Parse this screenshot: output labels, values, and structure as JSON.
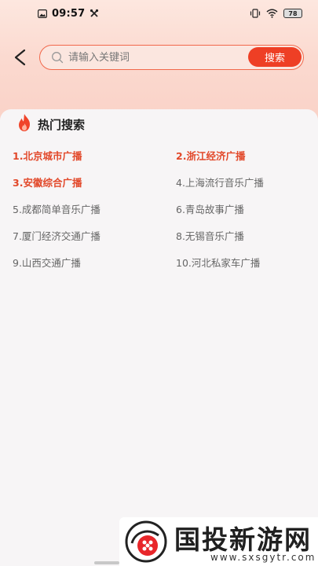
{
  "status_bar": {
    "time": "09:57",
    "battery": "78",
    "icons": [
      "image-icon",
      "tools-icon",
      "vibrate-icon",
      "wifi-icon",
      "battery-icon"
    ]
  },
  "search": {
    "placeholder": "请输入关键词",
    "value": "",
    "button_label": "搜索"
  },
  "hot_section": {
    "title": "热门搜索",
    "icon": "flame-icon",
    "items": [
      {
        "label": "1.北京城市广播"
      },
      {
        "label": "2.浙江经济广播"
      },
      {
        "label": "3.安徽综合广播"
      },
      {
        "label": "4.上海流行音乐广播"
      },
      {
        "label": "5.成都简单音乐广播"
      },
      {
        "label": "6.青岛故事广播"
      },
      {
        "label": "7.厦门经济交通广播"
      },
      {
        "label": "8.无锡音乐广播"
      },
      {
        "label": "9.山西交通广播"
      },
      {
        "label": "10.河北私家车广播"
      }
    ]
  },
  "watermark": {
    "title": "国投新游网",
    "url": "www.sxsgytr.com"
  },
  "colors": {
    "accent": "#ee3f25",
    "hot_text": "#e2482a",
    "normal_text": "#666666"
  }
}
